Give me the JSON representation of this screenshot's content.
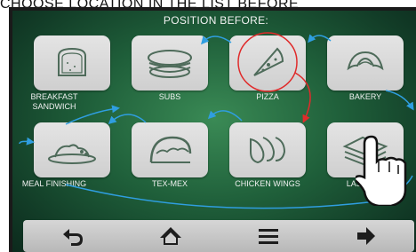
{
  "instruction": "CHOOSE LOCATION IN THE LIST BEFORE",
  "header": {
    "title": "POSITION BEFORE:"
  },
  "tiles": [
    {
      "label": "BREAKFAST SANDWICH",
      "icon": "sandwich-icon"
    },
    {
      "label": "SUBS",
      "icon": "sub-sandwich-icon"
    },
    {
      "label": "PIZZA",
      "icon": "pizza-icon"
    },
    {
      "label": "BAKERY",
      "icon": "croissant-icon"
    },
    {
      "label": "MEAL FINISHING",
      "icon": "meal-plate-icon"
    },
    {
      "label": "TEX-MEX",
      "icon": "taco-icon"
    },
    {
      "label": "CHICKEN WINGS",
      "icon": "chicken-wings-icon"
    },
    {
      "label": "LASAGNA",
      "icon": "lasagna-icon"
    }
  ],
  "nav": {
    "items": [
      {
        "icon": "back-arrow-icon"
      },
      {
        "icon": "home-icon"
      },
      {
        "icon": "menu-icon"
      },
      {
        "icon": "forward-arrow-icon"
      }
    ]
  },
  "colors": {
    "flow_arrow": "#2f9ee0",
    "selected_arrow": "#e02b2b",
    "tile_bg": "#dadada",
    "icon_stroke": "#4e6b5a"
  }
}
